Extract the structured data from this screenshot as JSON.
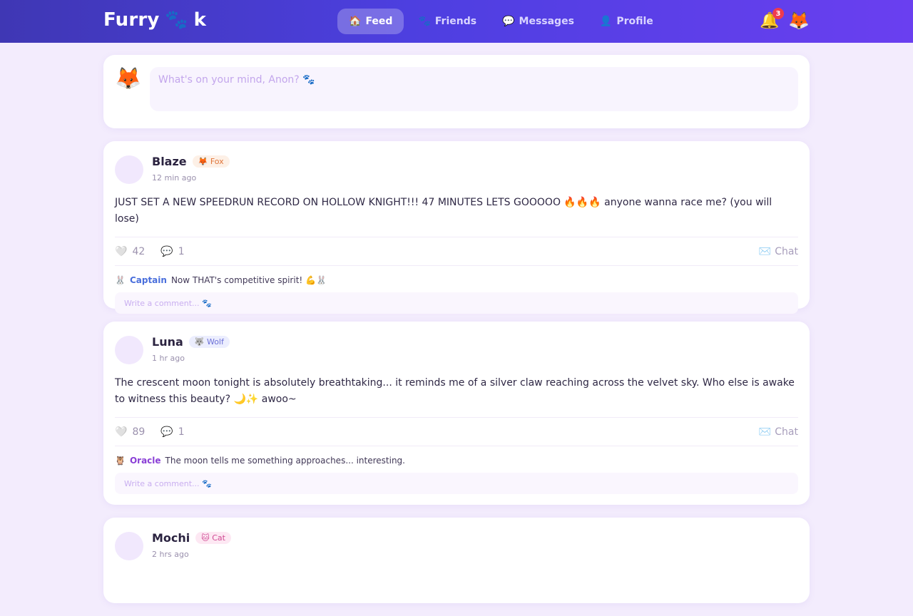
{
  "nav": {
    "logo_left": "Furry",
    "logo_right": "k",
    "logo_paw": "🐾",
    "links": [
      {
        "icon": "🏠",
        "label": "Feed"
      },
      {
        "icon": "🐾",
        "label": "Friends"
      },
      {
        "icon": "💬",
        "label": "Messages"
      },
      {
        "icon": "👤",
        "label": "Profile"
      }
    ],
    "bell_icon": "🔔",
    "notification_count": "3",
    "user_avatar": "🦊"
  },
  "composer": {
    "avatar": "🦊",
    "placeholder": "What's on your mind, Anon? 🐾"
  },
  "posts": [
    {
      "name": "Blaze",
      "species": "🦊 Fox",
      "time": "12 min ago",
      "text": "JUST SET A NEW SPEEDRUN RECORD ON HOLLOW KNIGHT!!! 47 MINUTES LETS GOOOOO 🔥🔥🔥 anyone wanna race me? (you will lose)",
      "likes": "42",
      "comments": "1",
      "chat_label": "Chat",
      "comment": {
        "icon": "🐰",
        "author": "Captain",
        "text": "Now THAT's competitive spirit! 💪🐰"
      },
      "comment_placeholder": "Write a comment... 🐾"
    },
    {
      "name": "Luna",
      "species": "🐺 Wolf",
      "time": "1 hr ago",
      "text": "The crescent moon tonight is absolutely breathtaking... it reminds me of a silver claw reaching across the velvet sky. Who else is awake to witness this beauty? 🌙✨ awoo~",
      "likes": "89",
      "comments": "1",
      "chat_label": "Chat",
      "comment": {
        "icon": "🦉",
        "author": "Oracle",
        "text": "The moon tells me something approaches... interesting."
      },
      "comment_placeholder": "Write a comment... 🐾"
    },
    {
      "name": "Mochi",
      "species": "🐱 Cat",
      "time": "2 hrs ago"
    }
  ],
  "icons": {
    "like": "🤍",
    "comment": "💬",
    "chat": "✉️"
  },
  "colors": {
    "nav_gradient_start": "#3f37b4",
    "nav_gradient_end": "#6a3ff0",
    "page_bg": "#f3ecfd",
    "notification_badge": "#ef3b4f"
  }
}
